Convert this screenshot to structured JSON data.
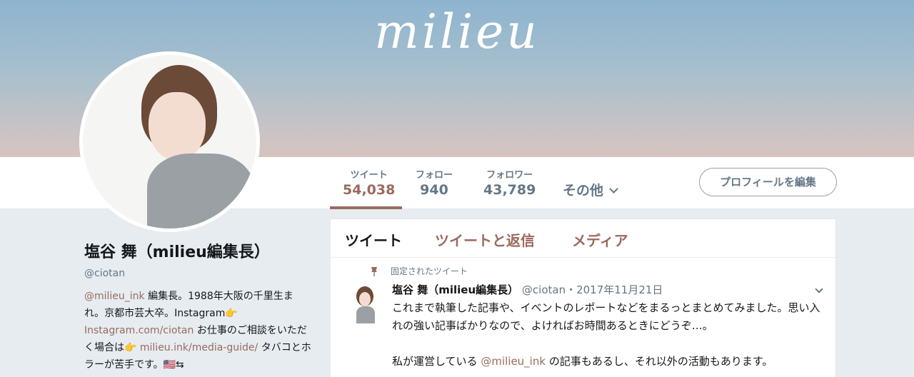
{
  "banner": {
    "logo_text": "milieu"
  },
  "nav": {
    "stats": [
      {
        "label": "ツイート",
        "value": "54,038"
      },
      {
        "label": "フォロー",
        "value": "940"
      },
      {
        "label": "フォロワー",
        "value": "43,789"
      }
    ],
    "more_label": "その他",
    "edit_profile_label": "プロフィールを編集"
  },
  "profile": {
    "name": "塩谷 舞（milieu編集長）",
    "handle": "@ciotan",
    "bio": {
      "mention": "@milieu_ink",
      "text1": " 編集長。1988年大阪の千里生まれ。京都市芸大卒。Instagram👉",
      "link1": "Instagram.com/ciotan",
      "text2": " お仕事のご相談をいただく場合は👉 ",
      "link2": "milieu.ink/media-guide/",
      "text3": " タバコとホラーが苦手です。🇺🇸⇆"
    }
  },
  "timeline": {
    "tabs": [
      "ツイート",
      "ツイートと返信",
      "メディア"
    ],
    "pinned_label": "固定されたツイート",
    "tweet": {
      "name": "塩谷 舞（milieu編集長）",
      "meta": " @ciotan・2017年11月21日",
      "text1": "これまで執筆した記事や、イベントのレポートなどをまるっとまとめてみました。思い入れの強い記事ばかりなので、よければお時間あるときにどうぞ…。",
      "text2_pre": "私が運営している ",
      "text2_mention": "@milieu_ink",
      "text2_post": " の記事もあるし、それ以外の活動もあります。"
    }
  },
  "colors": {
    "accent": "#9a6a5e",
    "muted": "#657786",
    "background": "#e6ecf0"
  }
}
